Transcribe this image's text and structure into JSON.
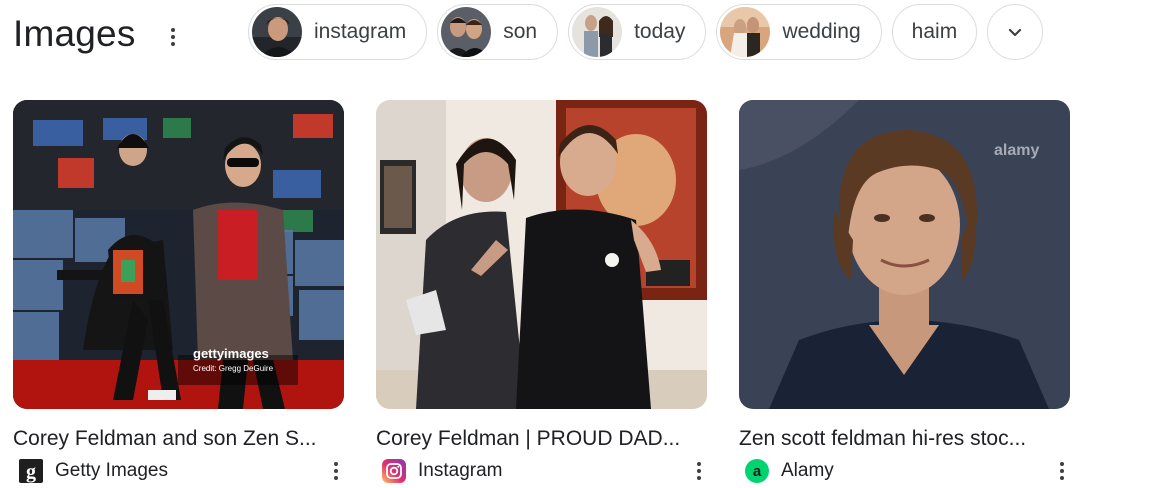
{
  "section": {
    "title": "Images"
  },
  "chips": [
    {
      "label": "instagram",
      "thumb": "portrait"
    },
    {
      "label": "son",
      "thumb": "pair"
    },
    {
      "label": "today",
      "thumb": "couple"
    },
    {
      "label": "wedding",
      "thumb": "wedding"
    },
    {
      "label": "haim",
      "thumb": null
    }
  ],
  "expand_icon": "chevron-down-icon",
  "results": [
    {
      "title": "Corey Feldman and son Zen S...",
      "source": "Getty Images",
      "source_icon": "getty-icon",
      "watermark": "gettyimages",
      "credit": "Credit: Gregg DeGuire"
    },
    {
      "title": "Corey Feldman | PROUD DAD...",
      "source": "Instagram",
      "source_icon": "instagram-icon"
    },
    {
      "title": "Zen scott feldman hi-res stoc...",
      "source": "Alamy",
      "source_icon": "alamy-icon",
      "watermark": "alamy"
    }
  ],
  "colors": {
    "text": "#202124",
    "border": "#dadce0",
    "alamy_green": "#00d36f"
  }
}
